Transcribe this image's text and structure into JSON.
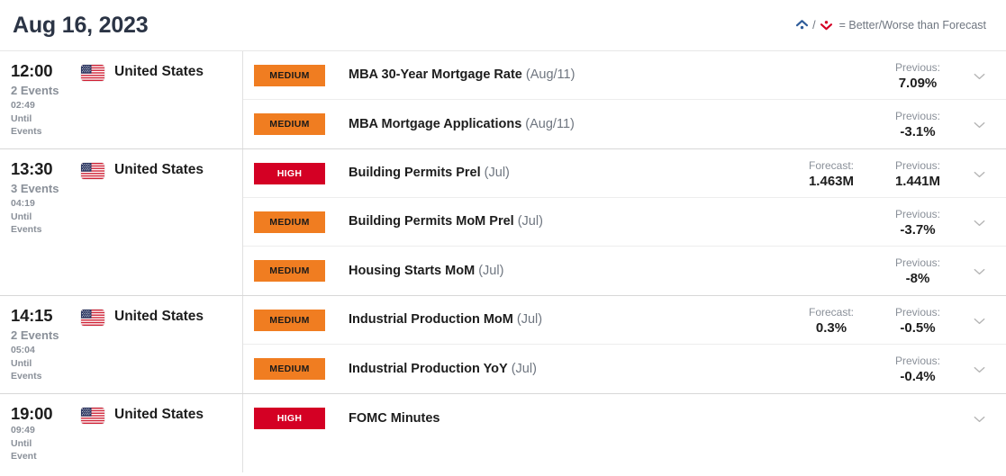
{
  "header": {
    "title": "Aug 16, 2023",
    "legend": {
      "better_icon": "caret-up-dot-icon",
      "separator": "/",
      "worse_icon": "caret-down-dot-icon",
      "text": "= Better/Worse than Forecast",
      "better_color": "#2e5c9a",
      "worse_color": "#d40024"
    }
  },
  "labels": {
    "forecast": "Forecast:",
    "previous": "Previous:",
    "until": "Until",
    "events_word": "Events",
    "event_word": "Event",
    "expander_icon": "chevron-down-icon",
    "flag_icon": "us-flag-icon"
  },
  "colors": {
    "medium": "#f07d21",
    "high": "#d40024",
    "title": "#2b3445",
    "muted": "#8a9099"
  },
  "groups": [
    {
      "time": "12:00",
      "event_count": "2 Events",
      "countdown": "02:49",
      "until": "Until",
      "unit": "Events",
      "country": "United States",
      "rows": [
        {
          "impact": "MEDIUM",
          "impact_class": "medium",
          "name": "MBA 30-Year Mortgage Rate",
          "period": "(Aug/11)",
          "forecast_label": "",
          "forecast": "",
          "previous_label": "Previous:",
          "previous": "7.09%"
        },
        {
          "impact": "MEDIUM",
          "impact_class": "medium",
          "name": "MBA Mortgage Applications",
          "period": "(Aug/11)",
          "forecast_label": "",
          "forecast": "",
          "previous_label": "Previous:",
          "previous": "-3.1%"
        }
      ]
    },
    {
      "time": "13:30",
      "event_count": "3 Events",
      "countdown": "04:19",
      "until": "Until",
      "unit": "Events",
      "country": "United States",
      "rows": [
        {
          "impact": "HIGH",
          "impact_class": "high",
          "name": "Building Permits Prel",
          "period": "(Jul)",
          "forecast_label": "Forecast:",
          "forecast": "1.463M",
          "previous_label": "Previous:",
          "previous": "1.441M"
        },
        {
          "impact": "MEDIUM",
          "impact_class": "medium",
          "name": "Building Permits MoM Prel",
          "period": "(Jul)",
          "forecast_label": "",
          "forecast": "",
          "previous_label": "Previous:",
          "previous": "-3.7%"
        },
        {
          "impact": "MEDIUM",
          "impact_class": "medium",
          "name": "Housing Starts MoM",
          "period": "(Jul)",
          "forecast_label": "",
          "forecast": "",
          "previous_label": "Previous:",
          "previous": "-8%"
        }
      ]
    },
    {
      "time": "14:15",
      "event_count": "2 Events",
      "countdown": "05:04",
      "until": "Until",
      "unit": "Events",
      "country": "United States",
      "rows": [
        {
          "impact": "MEDIUM",
          "impact_class": "medium",
          "name": "Industrial Production MoM",
          "period": "(Jul)",
          "forecast_label": "Forecast:",
          "forecast": "0.3%",
          "previous_label": "Previous:",
          "previous": "-0.5%"
        },
        {
          "impact": "MEDIUM",
          "impact_class": "medium",
          "name": "Industrial Production YoY",
          "period": "(Jul)",
          "forecast_label": "",
          "forecast": "",
          "previous_label": "Previous:",
          "previous": "-0.4%"
        }
      ]
    },
    {
      "time": "19:00",
      "event_count": "",
      "countdown": "09:49",
      "until": "Until",
      "unit": "Event",
      "country": "United States",
      "rows": [
        {
          "impact": "HIGH",
          "impact_class": "high",
          "name": "FOMC Minutes",
          "period": "",
          "forecast_label": "",
          "forecast": "",
          "previous_label": "",
          "previous": ""
        }
      ]
    }
  ]
}
